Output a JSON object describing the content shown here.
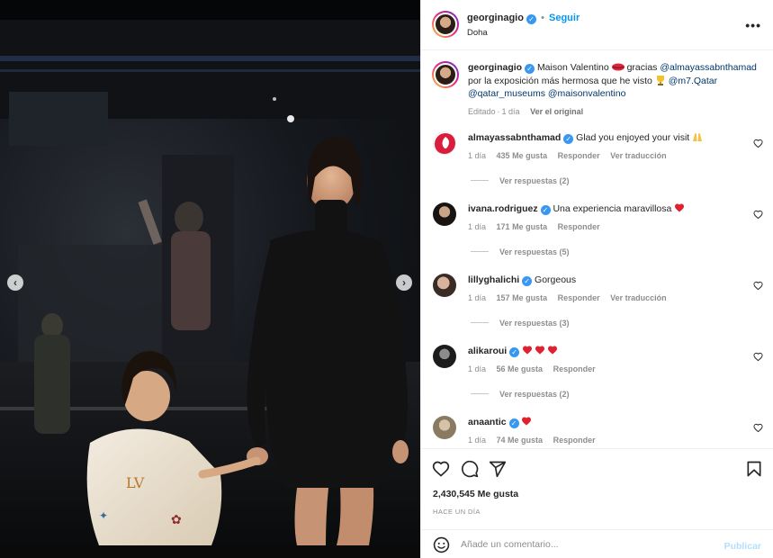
{
  "post": {
    "username": "georginagio",
    "follow_label": "Seguir",
    "location": "Doha",
    "more_icon": "more-horizontal-icon",
    "caption": {
      "username": "georginagio",
      "parts": [
        "Maison Valentino",
        "gracias",
        "@almayassabnthamad",
        "por la exposición más hermosa que he visto",
        "@m7.Qatar",
        "@qatar_museums",
        "@maisonvalentino"
      ],
      "edited_label": "Editado",
      "time": "1 día",
      "see_original": "Ver el original"
    }
  },
  "comments": [
    {
      "username": "almayassabnthamad",
      "text": "Glad you enjoyed your visit",
      "emoji": "praise-hands-emoji",
      "time": "1 día",
      "likes": "435 Me gusta",
      "reply": "Responder",
      "translate": "Ver traducción",
      "replies": "Ver respuestas (2)"
    },
    {
      "username": "ivana.rodriguez",
      "text": "Una experiencia maravillosa",
      "emoji": "red-heart-emoji",
      "time": "1 día",
      "likes": "171 Me gusta",
      "reply": "Responder",
      "translate": "",
      "replies": "Ver respuestas (5)"
    },
    {
      "username": "lillyghalichi",
      "text": "Gorgeous",
      "emoji": "",
      "time": "1 día",
      "likes": "157 Me gusta",
      "reply": "Responder",
      "translate": "Ver traducción",
      "replies": "Ver respuestas (3)"
    },
    {
      "username": "alikaroui",
      "text": "",
      "emoji": "three-red-hearts-emoji",
      "time": "1 día",
      "likes": "56 Me gusta",
      "reply": "Responder",
      "translate": "",
      "replies": "Ver respuestas (2)"
    },
    {
      "username": "anaantic",
      "text": "",
      "emoji": "red-heart-emoji",
      "time": "1 día",
      "likes": "74 Me gusta",
      "reply": "Responder",
      "translate": "",
      "replies": ""
    }
  ],
  "actions": {
    "likes": "2,430,545 Me gusta",
    "ago": "HACE UN DÍA"
  },
  "composer": {
    "placeholder": "Añade un comentario...",
    "publish_label": "Publicar"
  },
  "carousel": {
    "slide_count": 10,
    "active_index": 7
  },
  "colors": {
    "accent": "#0095f6",
    "verified": "#3897f0",
    "link": "#00376b",
    "heart": "#ed1c24"
  }
}
